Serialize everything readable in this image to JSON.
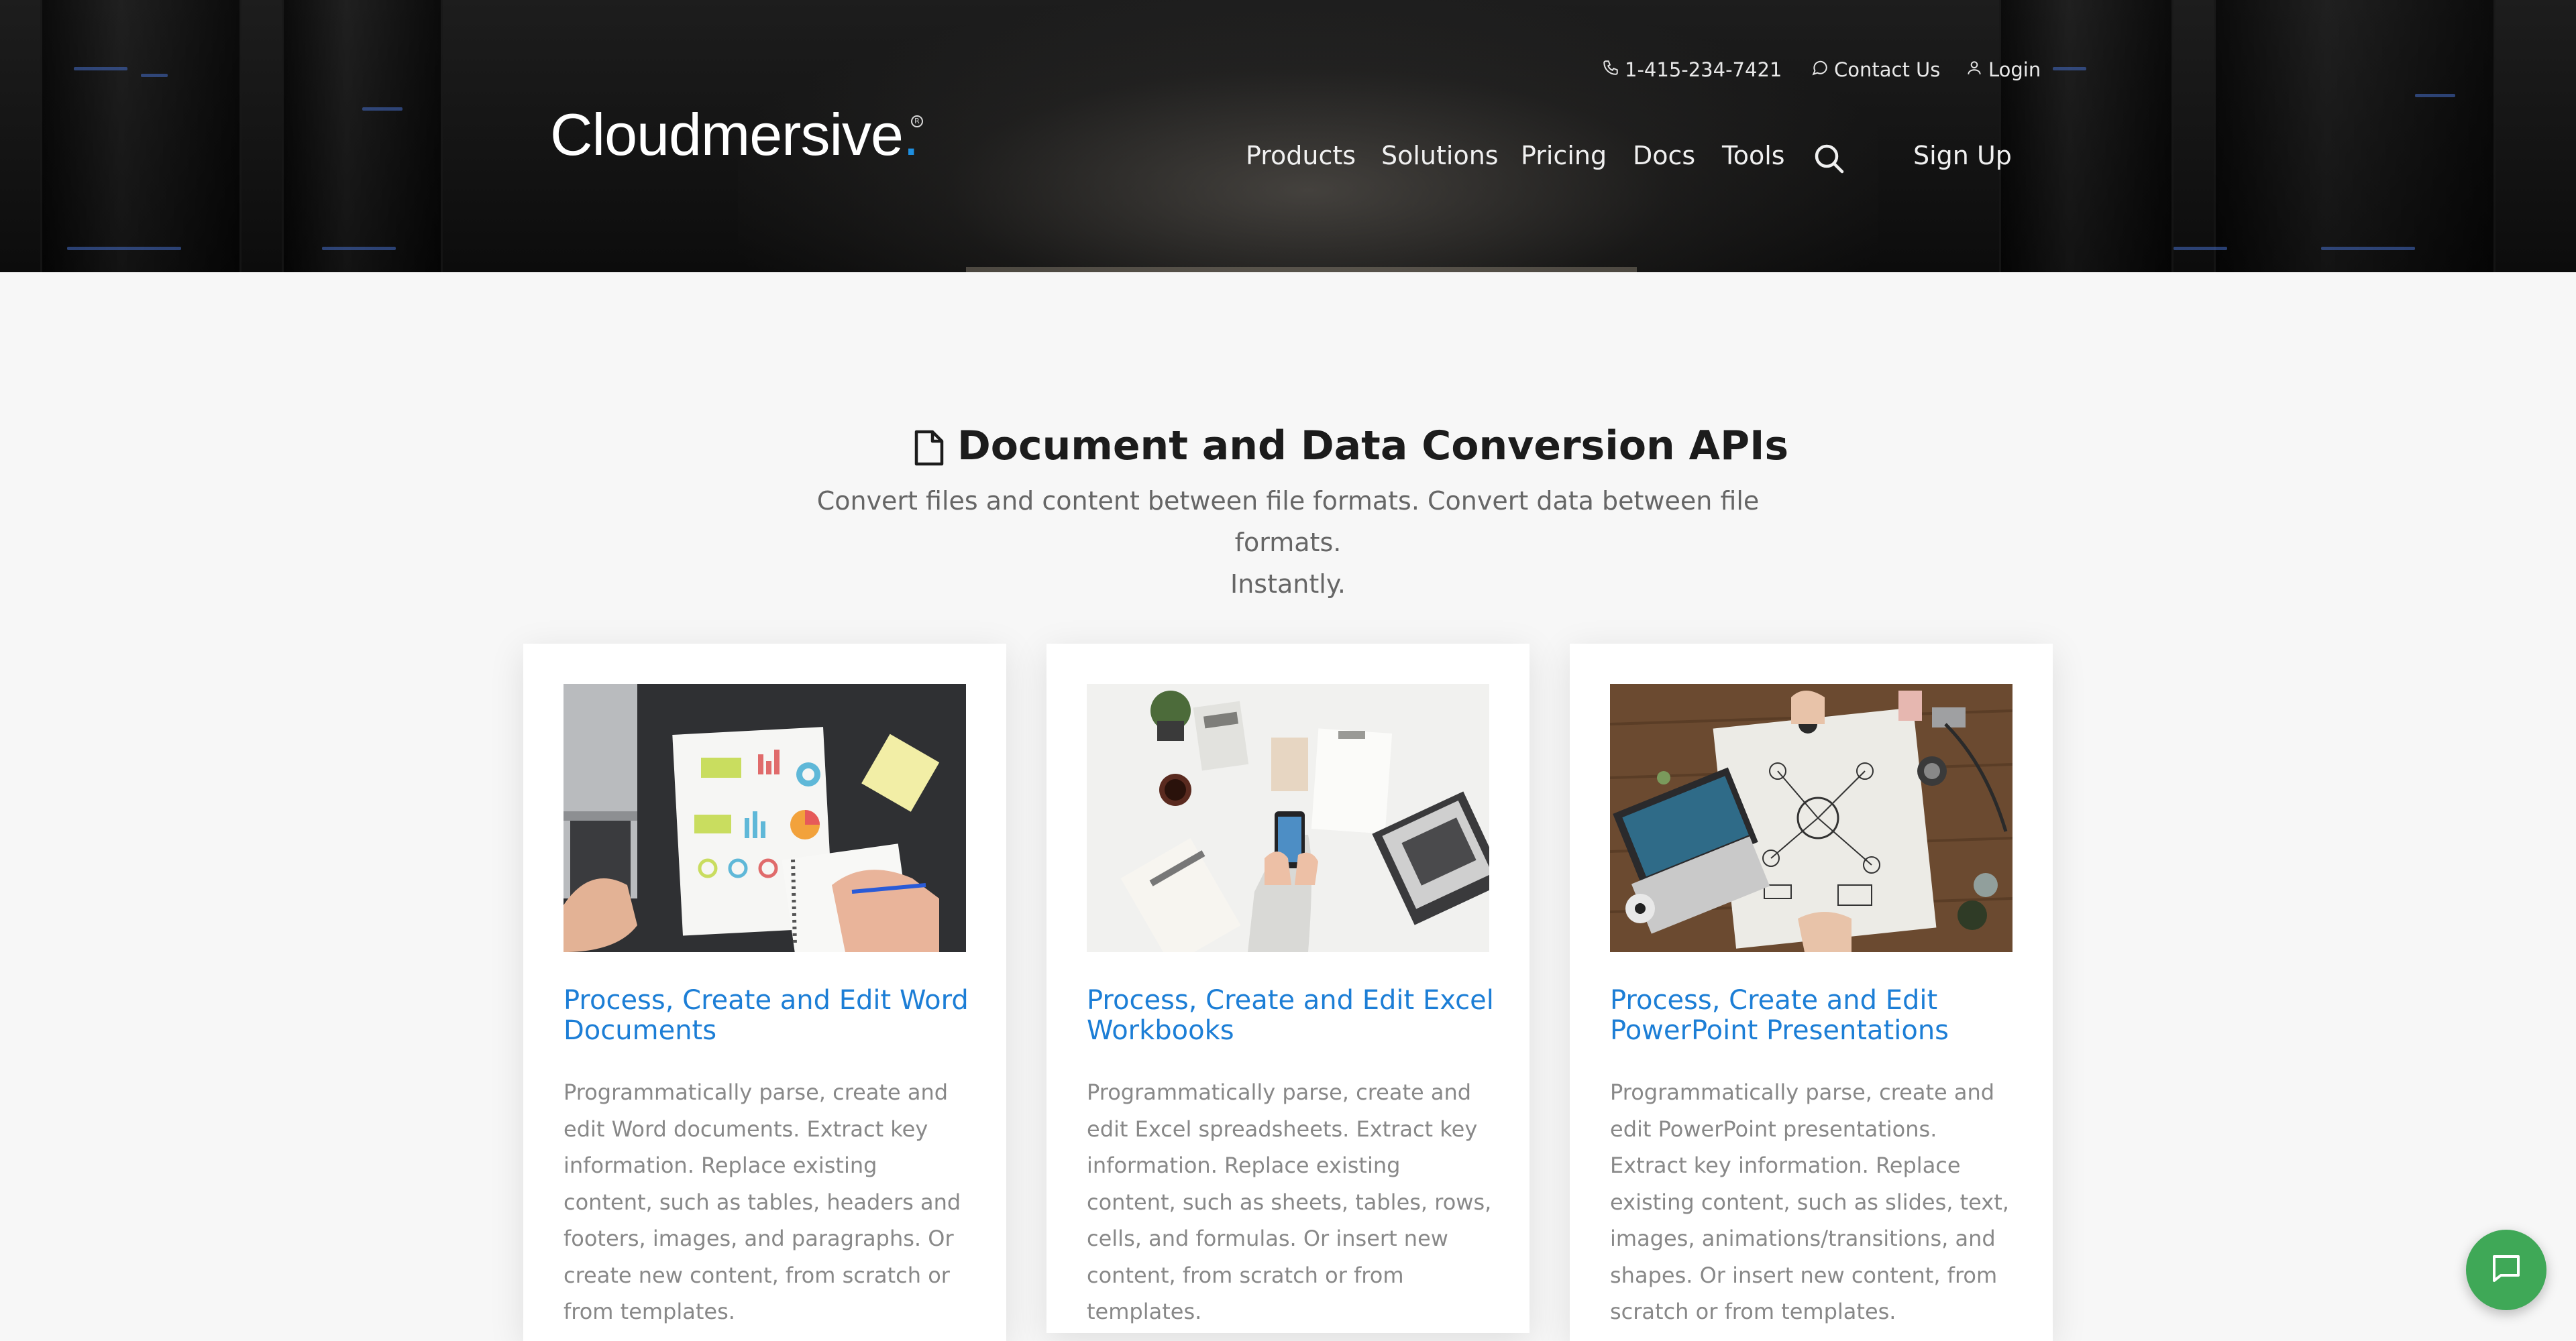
{
  "header": {
    "logo_text": "Cloudmersive",
    "logo_dot": ".",
    "logo_reg": "R",
    "phone": "1-415-234-7421",
    "contact": "Contact Us",
    "login": "Login",
    "nav": [
      "Products",
      "Solutions",
      "Pricing",
      "Docs",
      "Tools"
    ],
    "signup": "Sign Up",
    "icons": {
      "phone": "phone-icon",
      "contact": "chat-bubble-icon",
      "login": "user-icon",
      "search": "search-icon"
    }
  },
  "intro": {
    "title": "Document and Data Conversion APIs",
    "subtitle_line1": "Convert files and content between file formats. Convert data between file formats.",
    "subtitle_line2": "Instantly.",
    "icon": "document-icon"
  },
  "cards": [
    {
      "title_line1": "Process, Create and Edit Word",
      "title_line2": "Documents",
      "body": "Programmatically parse, create and edit Word documents. Extract key information. Replace existing content, such as tables, headers and footers, images, and paragraphs. Or create new content, from scratch or from templates.",
      "image": "laptop-charts-photo"
    },
    {
      "title_line1": "Process, Create and Edit Excel",
      "title_line2": "Workbooks",
      "body": "Programmatically parse, create and edit Excel spreadsheets. Extract key information. Replace existing content, such as sheets, tables, rows, cells, and formulas. Or insert new content, from scratch or from templates.",
      "image": "desk-phone-photo"
    },
    {
      "title_line1": "Process, Create and Edit",
      "title_line2": "PowerPoint Presentations",
      "body": "Programmatically parse, create and edit PowerPoint presentations. Extract key information. Replace existing content, such as slides, text, images, animations/transitions, and shapes. Or insert new content, from scratch or from templates.",
      "image": "business-sketch-photo"
    }
  ],
  "chat": {
    "icon": "chat-icon"
  },
  "colors": {
    "accent": "#1c7ed6",
    "chat": "#3fa857",
    "logo_dot": "#1e8fe0"
  }
}
